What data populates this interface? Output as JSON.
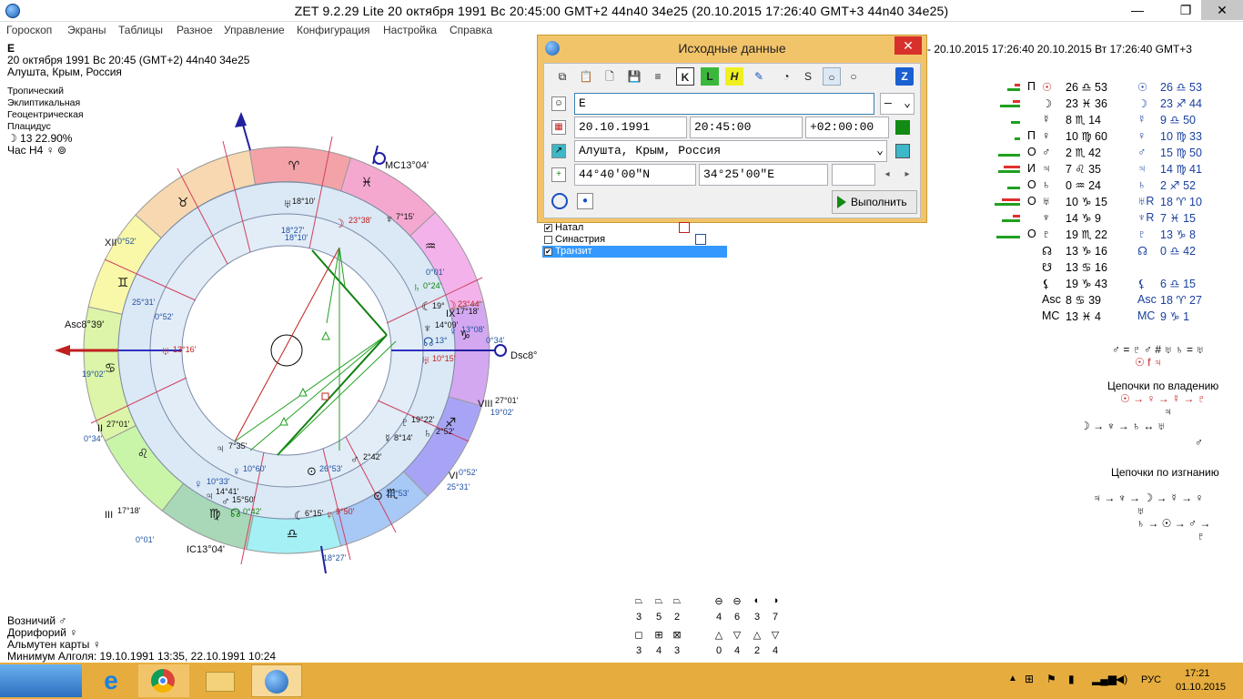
{
  "window": {
    "title": "ZET 9.2.29 Lite    20 октября 1991   Вс   20:45:00 GMT+2 44n40   34e25   (20.10.2015   17:26:40 GMT+3 44n40 34e25)",
    "minimize": "—",
    "maximize": "❐",
    "close": "✕"
  },
  "menu": [
    "Гороскоп",
    "Экраны",
    "Таблицы",
    "Разное",
    "Управление",
    "Конфигурация",
    "Настройка",
    "Справка"
  ],
  "chart_info": {
    "name": "Е",
    "date_line": "20 октября 1991   Вс   20:45 (GMT+2) 44n40   34e25",
    "place": "Алушта, Крым, Россия",
    "zodiac": "Тропический",
    "coords": "Эклиптикальная",
    "center": "Геоцентрическая",
    "houses": "Плацидус",
    "moon_phase": "☽   13 22.90%",
    "hour": "Час Н4  ♀ ⊚"
  },
  "transit_header": "- 20.10.2015 17:26:40 20.10.2015   Вт 17:26:40 GMT+3",
  "planet_table": [
    {
      "flag": "П",
      "g": "☉",
      "pos": "26 ♎ 53",
      "tg": "☉",
      "tpos": "26 ♎ 53"
    },
    {
      "flag": "",
      "g": "☽",
      "pos": "23 ♓ 36",
      "tg": "☽",
      "tpos": "23 ♐ 44"
    },
    {
      "flag": "",
      "g": "☿",
      "pos": "8 ♏ 14",
      "tg": "☿",
      "tpos": "9 ♎ 50"
    },
    {
      "flag": "П",
      "g": "♀",
      "pos": "10 ♍ 60",
      "tg": "♀",
      "tpos": "10 ♍ 33"
    },
    {
      "flag": "О",
      "g": "♂",
      "pos": "2 ♏ 42",
      "tg": "♂",
      "tpos": "15 ♍ 50"
    },
    {
      "flag": "И",
      "g": "♃",
      "pos": "7 ♌ 35",
      "tg": "♃",
      "tpos": "14 ♍ 41"
    },
    {
      "flag": "О",
      "g": "♄",
      "pos": "0 ♒ 24",
      "tg": "♄",
      "tpos": "2 ♐ 52"
    },
    {
      "flag": "О",
      "g": "♅",
      "pos": "10 ♑ 15",
      "tg": "♅R",
      "tpos": "18 ♈ 10"
    },
    {
      "flag": "",
      "g": "♆",
      "pos": "14 ♑ 9",
      "tg": "♆R",
      "tpos": "7 ♓ 15"
    },
    {
      "flag": "О",
      "g": "♇",
      "pos": "19 ♏ 22",
      "tg": "♇",
      "tpos": "13 ♑ 8"
    },
    {
      "flag": "",
      "g": "☊",
      "pos": "13 ♑ 16",
      "tg": "☊",
      "tpos": "0 ♎ 42"
    },
    {
      "flag": "",
      "g": "☋",
      "pos": "13 ♋ 16",
      "tg": "",
      "tpos": ""
    },
    {
      "flag": "",
      "g": "⚸",
      "pos": "19 ♑ 43",
      "tg": "⚸",
      "tpos": "6 ♎ 15"
    },
    {
      "flag": "",
      "g": "Asc",
      "pos": "8 ♋ 39",
      "tg": "Asc",
      "tpos": "18 ♈ 27"
    },
    {
      "flag": "",
      "g": "MC",
      "pos": "13 ♓ 4",
      "tg": "MC",
      "tpos": "9 ♑ 1"
    }
  ],
  "receptions": "♂ = ♇  ♂ # ♅  ♄ = ♅",
  "receptions2": "☉ f ♃",
  "chains_rule": {
    "title": "Цепочки по владению",
    "line1": "☉ → ♀ → ☿ → ♇",
    "line1b": "♃",
    "line2": "☽ → ♆ → ♄ ↔ ♅",
    "line2b": "♂"
  },
  "chains_exile": {
    "title": "Цепочки по изгнанию",
    "line1": "♃ → ♆ → ☽ → ☿ → ♀",
    "line1b": "♅",
    "line2": "♄ → ☉ → ♂ →",
    "line2b": "♇"
  },
  "dialog": {
    "title": "Исходные данные",
    "close": "✕",
    "name_value": "Е",
    "name_dropdown": "—",
    "date": "20.10.1991",
    "time": "20:45:00",
    "tz": "+02:00:00",
    "place": "Алушта, Крым, Россия",
    "lat": "44°40'00\"N",
    "lon": "34°25'00\"E",
    "execute": "Выполнить",
    "toolbar": [
      "⧉",
      "📋",
      "🗋",
      "💾",
      "≡",
      "K",
      "L",
      "H",
      "✎",
      "◔",
      "Ѕ",
      "○",
      "○",
      "Z"
    ]
  },
  "chart_list": [
    {
      "label": "Натал",
      "checked": true
    },
    {
      "label": "Синастрия",
      "checked": false
    },
    {
      "label": "Транзит",
      "checked": true
    }
  ],
  "bottom_info": {
    "vozn": "Возничий  ♂",
    "dor": "Дорифорий  ♀",
    "alm": "Альмутен карты  ♀",
    "algol": "Минимум Алголя: 19.10.1991 13:35,  22.10.1991 10:24"
  },
  "aspect_counts": {
    "row1": [
      "3",
      "5",
      "2",
      "4",
      "6",
      "3",
      "7"
    ],
    "row2": [
      "3",
      "4",
      "3",
      "0",
      "4",
      "2",
      "4"
    ]
  },
  "wheel": {
    "signs": [
      "♈",
      "♉",
      "♊",
      "♋",
      "♌",
      "♍",
      "♎",
      "♏",
      "♐",
      "♑",
      "♒",
      "♓"
    ],
    "labels": {
      "mc": "MC13°04'",
      "ic": "IC13°04'",
      "asc": "Asc8°39'",
      "dsc": "Dsc8°39'",
      "h11": "XI",
      "h12": "XII",
      "h2": "II",
      "h3": "III",
      "h9": "IX",
      "h8": "VIII",
      "h6": "VI",
      "top_arrow": "18°27'",
      "top_arrow2": "18°10'",
      "d1": "25°31'",
      "d2": "0°52'",
      "d3": "19°02'",
      "d4": "27°01'",
      "d5": "0°34'",
      "d6": "17°18'",
      "d7": "0°01'",
      "d8": "17°18'",
      "d9": "0°34'",
      "d10": "27°01'",
      "d11": "19°02'",
      "d12": "0°52'",
      "d13": "25°31'",
      "d14": "0°01'",
      "pl1": "18°10'",
      "pl2": "23°38'",
      "pl3": "7°15'",
      "pl4": "0°24'",
      "pl5": "13°16'",
      "pl6": "19°",
      "pl7": "23°44'",
      "pl8": "14°09'",
      "pl9": "13°",
      "pl10": "13°08'",
      "pl11": "10°15'",
      "pl12": "19°22'",
      "pl13": "2°52'",
      "pl14": "8°14'",
      "pl15": "2°42'",
      "pl16": "26°53'",
      "pl17": "26°53'",
      "pl18": "7°35'",
      "pl19": "10°60'",
      "pl20": "10°33'",
      "pl21": "14°41'",
      "pl22": "15°50'",
      "pl23": "0°42'",
      "pl24": "6°15'",
      "pl25": "9°50'",
      "pl26": "18°27'"
    }
  },
  "taskbar": {
    "lang": "РУС",
    "time": "17:21",
    "date": "01.10.2015"
  }
}
